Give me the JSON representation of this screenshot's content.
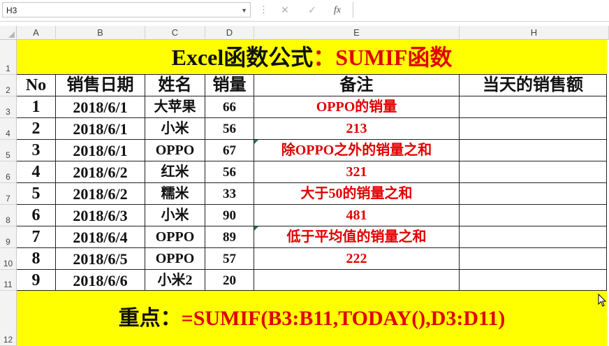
{
  "formula_bar": {
    "name_box": "H3",
    "cancel_icon": "✕",
    "enter_icon": "✓",
    "fx_label": "fx",
    "formula": ""
  },
  "columns": [
    "A",
    "B",
    "C",
    "D",
    "E",
    "H"
  ],
  "rows": [
    "1",
    "2",
    "3",
    "4",
    "5",
    "6",
    "7",
    "8",
    "9",
    "10",
    "11",
    "12"
  ],
  "title": {
    "part1": "Excel函数公式",
    "part2": "：SUMIF函数"
  },
  "headers": [
    "No",
    "销售日期",
    "姓名",
    "销量",
    "备注",
    "当天的销售额"
  ],
  "table": [
    {
      "no": "1",
      "date": "2018/6/1",
      "name": "大苹果",
      "qty": "66",
      "note": "OPPO的销量",
      "h": ""
    },
    {
      "no": "2",
      "date": "2018/6/1",
      "name": "小米",
      "qty": "56",
      "note": "213",
      "h": ""
    },
    {
      "no": "3",
      "date": "2018/6/1",
      "name": "OPPO",
      "qty": "67",
      "note": "除OPPO之外的销量之和",
      "h": ""
    },
    {
      "no": "4",
      "date": "2018/6/2",
      "name": "红米",
      "qty": "56",
      "note": "321",
      "h": ""
    },
    {
      "no": "5",
      "date": "2018/6/2",
      "name": "糯米",
      "qty": "33",
      "note": "大于50的销量之和",
      "h": ""
    },
    {
      "no": "6",
      "date": "2018/6/3",
      "name": "小米",
      "qty": "90",
      "note": "481",
      "h": ""
    },
    {
      "no": "7",
      "date": "2018/6/4",
      "name": "OPPO",
      "qty": "89",
      "note": "低于平均值的销量之和",
      "h": ""
    },
    {
      "no": "8",
      "date": "2018/6/5",
      "name": "OPPO",
      "qty": "57",
      "note": "222",
      "h": ""
    },
    {
      "no": "9",
      "date": "2018/6/6",
      "name": "小米2",
      "qty": "20",
      "note": "",
      "h": ""
    }
  ],
  "key_point": {
    "label": "重点：",
    "formula": "=SUMIF(B3:B11,TODAY(),D3:D11)"
  },
  "colors": {
    "highlight": "#ffff00",
    "accent_red": "#e00000"
  }
}
